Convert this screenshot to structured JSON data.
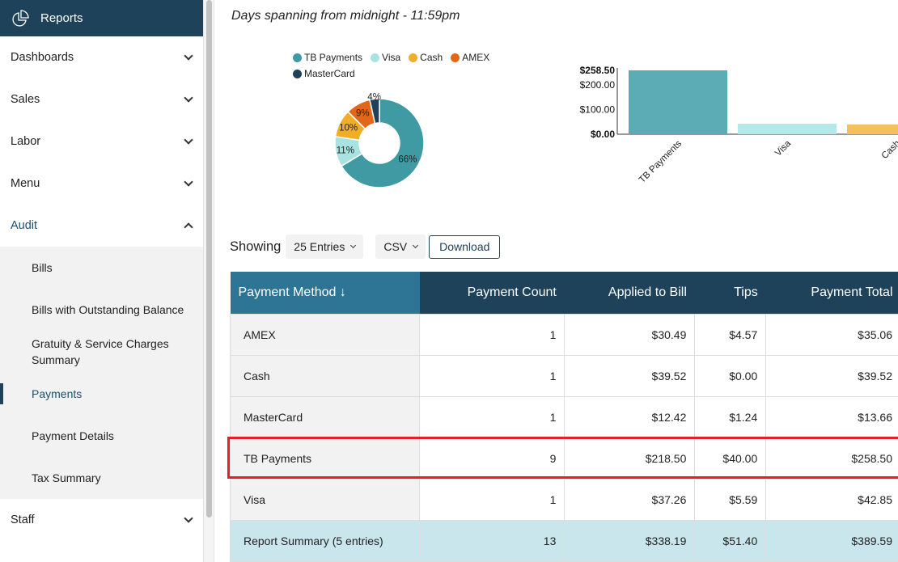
{
  "sidebar": {
    "header": "Reports",
    "items": [
      {
        "label": "Dashboards"
      },
      {
        "label": "Sales"
      },
      {
        "label": "Labor"
      },
      {
        "label": "Menu"
      },
      {
        "label": "Audit"
      }
    ],
    "audit_items": [
      {
        "label": "Bills"
      },
      {
        "label": "Bills with Outstanding Balance"
      },
      {
        "label": "Gratuity & Service Charges Summary"
      },
      {
        "label": "Payments",
        "active": true
      },
      {
        "label": "Payment Details"
      },
      {
        "label": "Tax Summary"
      }
    ],
    "after": [
      {
        "label": "Staff"
      }
    ]
  },
  "subtitle": "Days spanning from midnight - 11:59pm",
  "chart_data": [
    {
      "type": "pie",
      "donut": true,
      "legend": "top",
      "categories": [
        "TB Payments",
        "Visa",
        "Cash",
        "AMEX",
        "MasterCard"
      ],
      "values": [
        258.5,
        42.85,
        39.52,
        35.06,
        13.66
      ],
      "labels": [
        "66%",
        "11%",
        "10%",
        "9%",
        "4%"
      ],
      "colors": [
        "#3f9aa4",
        "#a8e3e1",
        "#f0ad27",
        "#e2671a",
        "#1d4259"
      ]
    },
    {
      "type": "bar",
      "categories": [
        "TB Payments",
        "Visa",
        "Cash"
      ],
      "values": [
        258.5,
        42.85,
        39.52
      ],
      "colors": [
        "#5bacb4",
        "#b5e8e8",
        "#f3c05c"
      ],
      "ylim": [
        0,
        258.5
      ],
      "yticks": [
        {
          "v": 258.5,
          "label": "$258.50",
          "bold": true
        },
        {
          "v": 200,
          "label": "$200.00"
        },
        {
          "v": 100,
          "label": "$100.00"
        },
        {
          "v": 0,
          "label": "$0.00",
          "bold": true
        }
      ]
    }
  ],
  "controls": {
    "showing": "Showing",
    "entries": "25 Entries",
    "format": "CSV",
    "download": "Download"
  },
  "table": {
    "headers": [
      "Payment Method ↓",
      "Payment Count",
      "Applied to Bill",
      "Tips",
      "Payment Total"
    ],
    "rows": [
      [
        "AMEX",
        "1",
        "$30.49",
        "$4.57",
        "$35.06"
      ],
      [
        "Cash",
        "1",
        "$39.52",
        "$0.00",
        "$39.52"
      ],
      [
        "MasterCard",
        "1",
        "$12.42",
        "$1.24",
        "$13.66"
      ],
      [
        "TB Payments",
        "9",
        "$218.50",
        "$40.00",
        "$258.50"
      ],
      [
        "Visa",
        "1",
        "$37.26",
        "$5.59",
        "$42.85"
      ]
    ],
    "summary": [
      "Report Summary (5 entries)",
      "13",
      "$338.19",
      "$51.40",
      "$389.59"
    ],
    "highlighted_row": 3
  }
}
